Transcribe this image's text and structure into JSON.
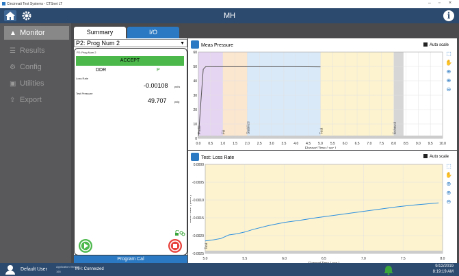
{
  "titlebar": {
    "title": "Cincinnati Test Systems - CTSnet LT",
    "minimize": "–",
    "restore": "▫",
    "close": "×"
  },
  "header": {
    "title": "MH",
    "info": "i"
  },
  "sidebar": {
    "items": [
      {
        "label": "Monitor",
        "icon": "monitor-icon",
        "active": true
      },
      {
        "label": "Results",
        "icon": "results-icon",
        "active": false
      },
      {
        "label": "Config",
        "icon": "config-icon",
        "active": false
      },
      {
        "label": "Utilities",
        "icon": "utilities-icon",
        "active": false
      },
      {
        "label": "Export",
        "icon": "export-icon",
        "active": false
      }
    ]
  },
  "tabs": {
    "summary": "Summary",
    "io": "I/O"
  },
  "program": {
    "selected": "P2: Prog Num 2",
    "sub_label": "P2: Prog Num 2",
    "result": "ACCEPT",
    "ddr_label": "DDR",
    "ddr_value": "P",
    "loss_rate_label": "Loss Rate",
    "loss_rate_value": "-0.00108",
    "loss_rate_unit": "psi/s",
    "test_pressure_label": "Test Pressure",
    "test_pressure_value": "49.707",
    "test_pressure_unit": "psig",
    "program_cal": "Program Cal"
  },
  "colors": {
    "accent": "#2b79c2",
    "header": "#2c4a6e",
    "sidebar": "#59595c",
    "accept": "#4cb84c",
    "stop": "#e8403a"
  },
  "chart_data": [
    {
      "type": "line",
      "title": "Meas Pressure",
      "xlabel": "Elapsed Time ( sec )",
      "ylabel": "Meas Pressure ( psig )",
      "xlim": [
        0,
        10
      ],
      "ylim": [
        0,
        60
      ],
      "xticks": [
        "0.0",
        "0.5",
        "1.0",
        "1.5",
        "2.0",
        "2.5",
        "3.0",
        "3.5",
        "4.0",
        "4.5",
        "5.0",
        "5.5",
        "6.0",
        "6.5",
        "7.0",
        "7.5",
        "8.0",
        "8.5",
        "9.0",
        "9.5",
        "10.0"
      ],
      "yticks": [
        "0",
        "10",
        "20",
        "30",
        "40",
        "50",
        "60"
      ],
      "phases": [
        {
          "name": "Prefill",
          "start": 0.0,
          "end": 1.0,
          "color": "#e6d5f2"
        },
        {
          "name": "Fill",
          "start": 1.0,
          "end": 2.0,
          "color": "#fbe6cf"
        },
        {
          "name": "Stabilize",
          "start": 2.0,
          "end": 5.0,
          "color": "#d9e9f8"
        },
        {
          "name": "Test",
          "start": 5.0,
          "end": 8.0,
          "color": "#fdf3cf"
        },
        {
          "name": "Exhaust",
          "start": 8.0,
          "end": 8.4,
          "color": "#d6d6d6"
        }
      ],
      "series": [
        {
          "values": [
            [
              0,
              0
            ],
            [
              0.1,
              25
            ],
            [
              0.2,
              48
            ],
            [
              0.3,
              49.8
            ],
            [
              1,
              49.8
            ],
            [
              2,
              49.8
            ],
            [
              3,
              49.8
            ],
            [
              4,
              49.8
            ],
            [
              5,
              49.7
            ]
          ]
        }
      ],
      "auto_scale": "Auto scale",
      "grid": true
    },
    {
      "type": "line",
      "title": "Test: Loss Rate",
      "xlabel": "Elapsed Time ( sec )",
      "ylabel": "Loss Rate ( psi/s )",
      "xlim": [
        5.0,
        8.0
      ],
      "ylim": [
        -0.0025,
        0.0
      ],
      "xticks": [
        "5.0",
        "5.5",
        "6.0",
        "6.5",
        "7.0",
        "7.5",
        "8.0"
      ],
      "yticks": [
        "0.0000",
        "-0.0005",
        "-0.0010",
        "-0.0015",
        "-0.0020",
        "-0.0025"
      ],
      "phases": [
        {
          "name": "Test",
          "start": 5.0,
          "end": 8.0,
          "color": "#fdf3cf"
        }
      ],
      "series": [
        {
          "values": [
            [
              5.0,
              -0.00215
            ],
            [
              5.1,
              -0.00212
            ],
            [
              5.2,
              -0.00208
            ],
            [
              5.3,
              -0.00198
            ],
            [
              5.4,
              -0.00195
            ],
            [
              5.5,
              -0.0019
            ],
            [
              5.6,
              -0.00183
            ],
            [
              5.8,
              -0.00172
            ],
            [
              6.0,
              -0.00163
            ],
            [
              6.2,
              -0.00157
            ],
            [
              6.4,
              -0.0015
            ],
            [
              6.6,
              -0.00144
            ],
            [
              6.8,
              -0.00138
            ],
            [
              7.0,
              -0.00132
            ],
            [
              7.2,
              -0.00126
            ],
            [
              7.4,
              -0.0012
            ],
            [
              7.6,
              -0.00115
            ],
            [
              7.8,
              -0.00111
            ],
            [
              7.95,
              -0.00108
            ]
          ]
        }
      ],
      "auto_scale": "Auto scale",
      "grid": true
    }
  ],
  "footer": {
    "user": "Default User",
    "app_version_label": "Application Version",
    "app_version": "165",
    "status": "MH: Connected",
    "date": "9/12/2019",
    "time": "8:19:19 AM"
  }
}
